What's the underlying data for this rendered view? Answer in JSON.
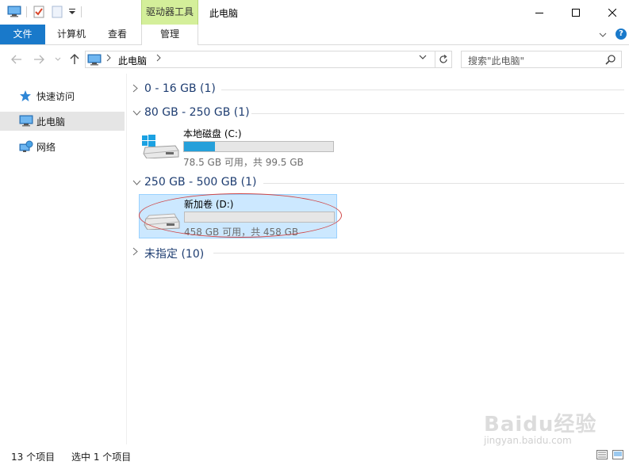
{
  "titlebar": {
    "context_tab_group": "驱动器工具",
    "window_title": "此电脑"
  },
  "ribbon": {
    "tabs": [
      {
        "label": "文件"
      },
      {
        "label": "计算机"
      },
      {
        "label": "查看"
      },
      {
        "label": "管理"
      }
    ],
    "accent_color": "#1979ca",
    "context_color": "#d4ef9a"
  },
  "address": {
    "crumb": "此电脑",
    "search_placeholder": "搜索\"此电脑\""
  },
  "navpane": {
    "items": [
      {
        "label": "快速访问",
        "icon": "star-icon"
      },
      {
        "label": "此电脑",
        "icon": "this-pc-icon",
        "selected": true
      },
      {
        "label": "网络",
        "icon": "network-icon"
      }
    ]
  },
  "groups": [
    {
      "title": "0 - 16 GB (1)",
      "expanded": false
    },
    {
      "title": "80 GB - 250 GB (1)",
      "expanded": true
    },
    {
      "title": "250 GB - 500 GB (1)",
      "expanded": true
    },
    {
      "title": "未指定 (10)",
      "expanded": false
    }
  ],
  "drives": [
    {
      "name": "本地磁盘 (C:)",
      "info": "78.5 GB 可用，共 99.5 GB",
      "used_fraction": 0.21,
      "icon": "windows-drive-icon"
    },
    {
      "name": "新加卷 (D:)",
      "info": "458 GB 可用，共 458 GB",
      "used_fraction": 0.0,
      "icon": "hard-drive-icon",
      "selected": true
    }
  ],
  "statusbar": {
    "count": "13 个项目",
    "selected": "选中 1 个项目"
  },
  "watermark": {
    "main": "Baidu经验",
    "url": "jingyan.baidu.com"
  }
}
